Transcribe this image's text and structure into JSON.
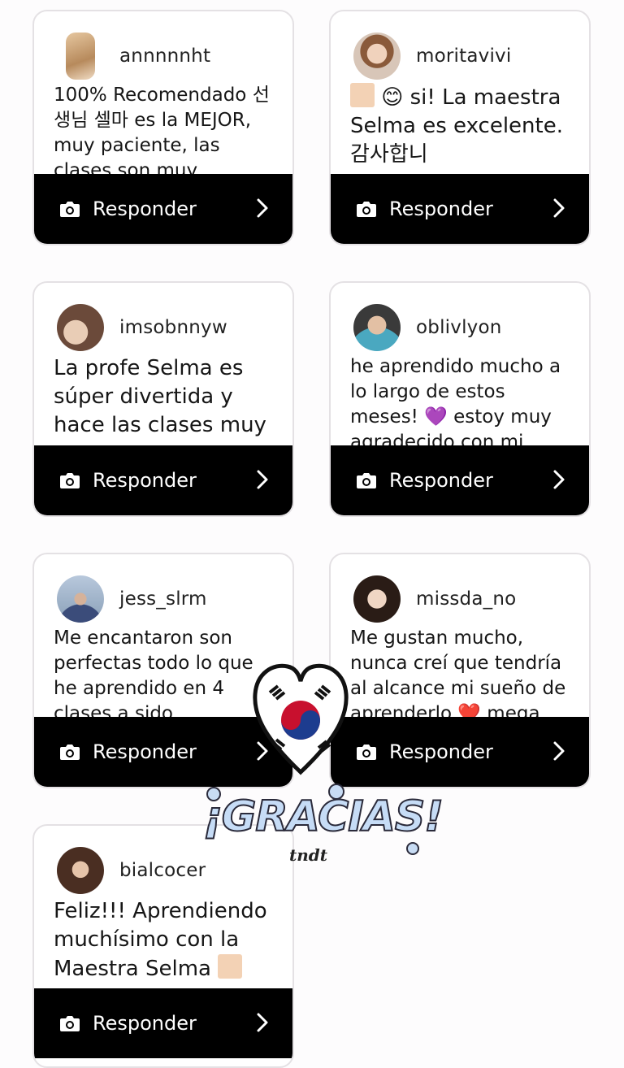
{
  "reply_label": "Responder",
  "cards": [
    {
      "user": "annnnnht",
      "text": "100% Recomendado 선생님 셀마 es la MEJOR, muy paciente, las clases son muy..."
    },
    {
      "user": "moritavivi",
      "text": "😊 si! La maestra Selma es excelente. 감사합니"
    },
    {
      "user": "imsobnnyw",
      "text": "La profe Selma es súper divertida y hace las clases muy ..."
    },
    {
      "user": "oblivlyon",
      "text": "he aprendido mucho a lo largo de estos meses! 💜 estoy muy agradecido con mi…"
    },
    {
      "user": "jess_slrm",
      "text": "Me encantaron son perfectas todo lo que he aprendido en 4 clases a sido…"
    },
    {
      "user": "missda_no",
      "text": "Me gustan mucho, nunca creí que tendría al alcance mi sueño de aprenderlo ❤️ mega…"
    },
    {
      "user": "bialcocer",
      "text": "Feliz!!! Aprendiendo muchísimo con la Maestra Selma"
    }
  ],
  "overlay": {
    "title": "¡GRACIAS!",
    "signature": "tndt"
  },
  "icons": {
    "camera": "camera-icon",
    "chevron": "chevron-right-icon"
  }
}
